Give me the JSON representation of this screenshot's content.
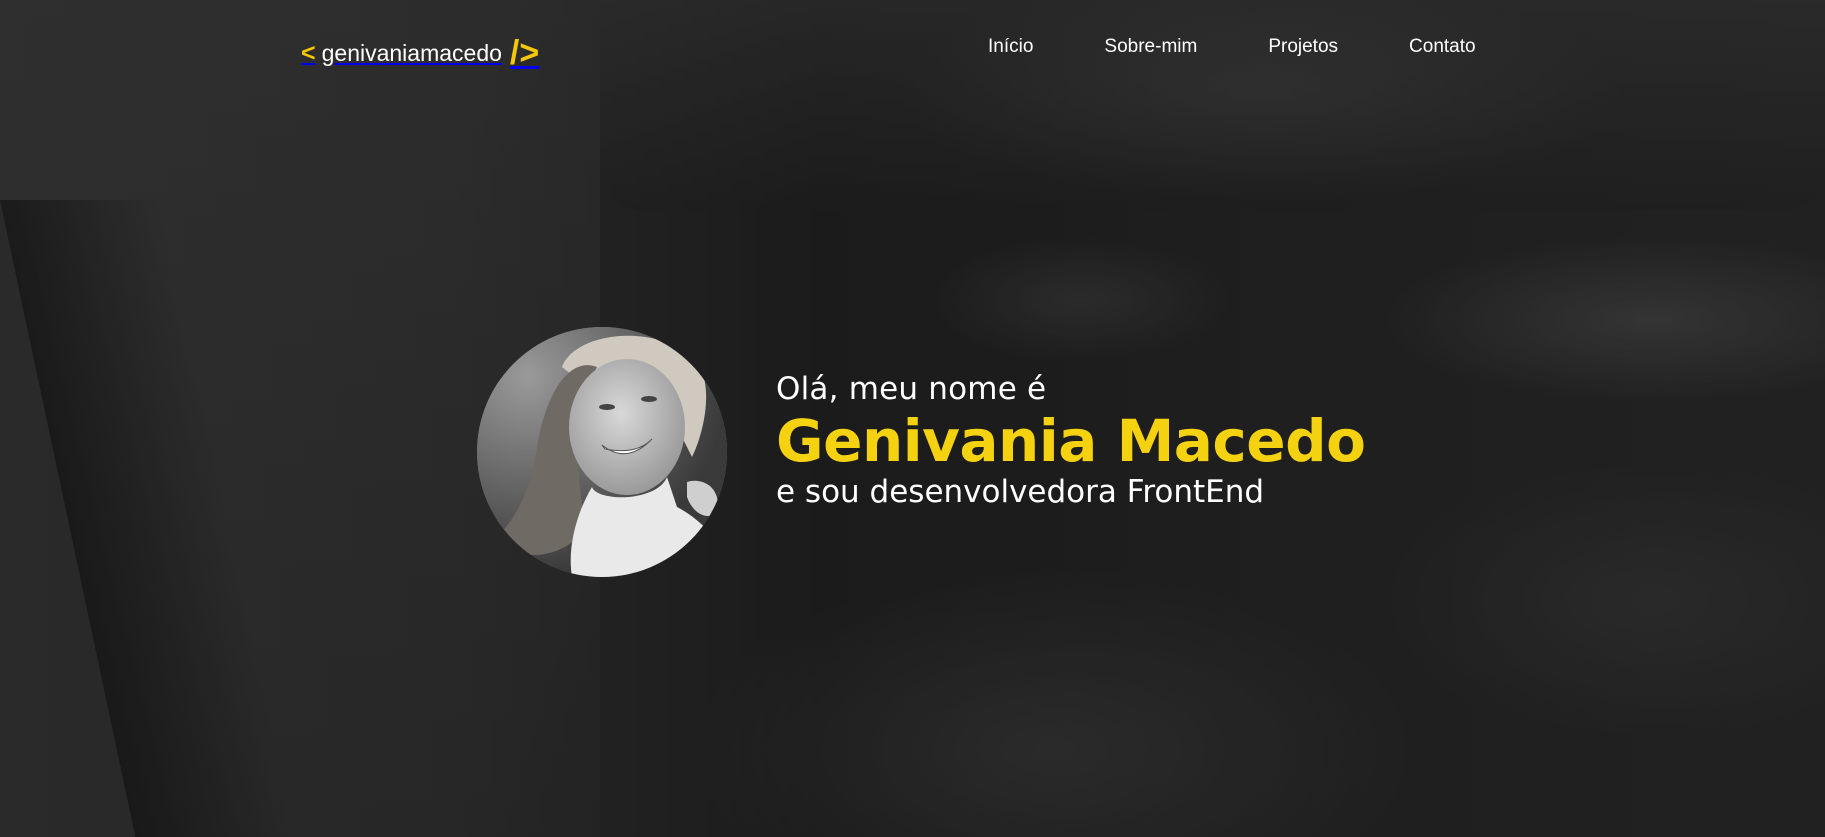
{
  "header": {
    "logo": {
      "open_bracket": "<",
      "name": "genivaniamacedo",
      "close_bracket": "/>"
    },
    "nav": [
      "Início",
      "Sobre-mim",
      "Projetos",
      "Contato"
    ]
  },
  "hero": {
    "greeting": "Olá, meu nome é",
    "name": "Genivania Macedo",
    "role": "e sou desenvolvedora FrontEnd",
    "photo_icon": "profile-photo-icon"
  },
  "colors": {
    "accent": "#f5d20f",
    "text": "#ffffff",
    "background": "#2a2a2a"
  }
}
